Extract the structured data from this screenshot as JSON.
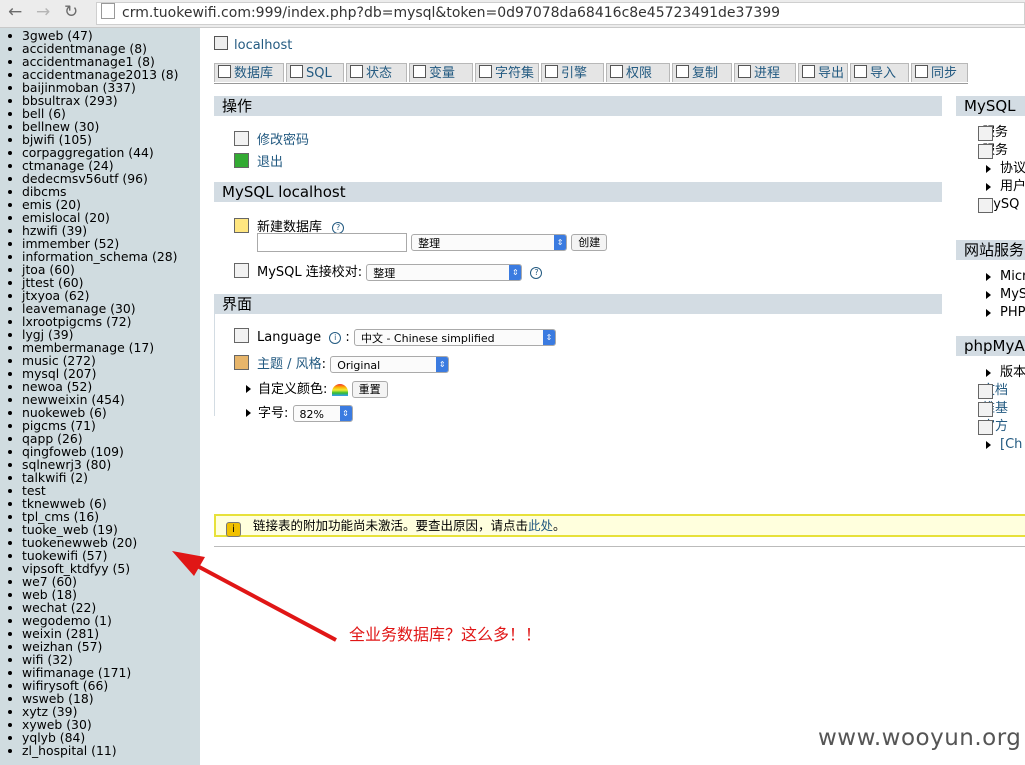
{
  "browser": {
    "back": "←",
    "forward": "→",
    "reload": "↻",
    "url": "crm.tuokewifi.com:999/index.php?db=mysql&token=0d97078da68416c8e45723491de37399"
  },
  "databases": [
    "3gweb (47)",
    "accidentmanage (8)",
    "accidentmanage1 (8)",
    "accidentmanage2013 (8)",
    "baijinmoban (337)",
    "bbsultrax (293)",
    "bell (6)",
    "bellnew (30)",
    "bjwifi (105)",
    "corpaggregation (44)",
    "ctmanage (24)",
    "dedecmsv56utf (96)",
    "dibcms",
    "emis (20)",
    "emislocal (20)",
    "hzwifi (39)",
    "immember (52)",
    "information_schema (28)",
    "jtoa (60)",
    "jttest (60)",
    "jtxyoa (62)",
    "leavemanage (30)",
    "lxrootpigcms (72)",
    "lygj (39)",
    "membermanage (17)",
    "music (272)",
    "mysql (207)",
    "newoa (52)",
    "newweixin (454)",
    "nuokeweb (6)",
    "pigcms (71)",
    "qapp (26)",
    "qingfoweb (109)",
    "sqlnewrj3 (80)",
    "talkwifi (2)",
    "test",
    "tknewweb (6)",
    "tpl_cms (16)",
    "tuoke_web (19)",
    "tuokenewweb (20)",
    "tuokewifi (57)",
    "vipsoft_ktdfyy (5)",
    "we7 (60)",
    "web (18)",
    "wechat (22)",
    "wegodemo (1)",
    "weixin (281)",
    "weizhan (57)",
    "wifi (32)",
    "wifimanage (171)",
    "wifirysoft (66)",
    "wsweb (18)",
    "xytz (39)",
    "xyweb (30)",
    "yqlyb (84)",
    "zl_hospital (11)"
  ],
  "server": "localhost",
  "tabs": [
    {
      "label": "数据库",
      "icon": "database-icon"
    },
    {
      "label": "SQL",
      "icon": "sql-icon"
    },
    {
      "label": "状态",
      "icon": "status-icon"
    },
    {
      "label": "变量",
      "icon": "variables-icon"
    },
    {
      "label": "字符集",
      "icon": "charset-icon"
    },
    {
      "label": "引擎",
      "icon": "engine-icon"
    },
    {
      "label": "权限",
      "icon": "privileges-icon"
    },
    {
      "label": "复制",
      "icon": "replication-icon"
    },
    {
      "label": "进程",
      "icon": "process-icon"
    },
    {
      "label": "导出",
      "icon": "export-icon"
    },
    {
      "label": "导入",
      "icon": "import-icon"
    },
    {
      "label": "同步",
      "icon": "sync-icon"
    }
  ],
  "ops": {
    "title": "操作",
    "change_password": "修改密码",
    "logout": "退出"
  },
  "mysql_local": {
    "title": "MySQL localhost",
    "new_db_label": "新建数据库",
    "help": "?",
    "collation_select": "整理",
    "create_button": "创建",
    "conn_collation_label": "MySQL 连接校对:",
    "conn_collation_value": "整理"
  },
  "ui": {
    "title": "界面",
    "language_label": "Language",
    "language_value": "中文 - Chinese simplified",
    "theme_label": "主题 / 风格",
    "theme_colon": ":",
    "theme_value": "Original",
    "custom_color_label": "自定义颜色:",
    "reset_button": "重置",
    "font_size_label": "字号:",
    "font_size_value": "82%"
  },
  "right_panel": {
    "mysql_title": "MySQL",
    "mysql_items": [
      "服务",
      "服务",
      "协议",
      "用户",
      "MySQ"
    ],
    "web_title": "网站服务",
    "web_items": [
      "Micr",
      "MyS",
      "PHP"
    ],
    "pma_title": "phpMyA",
    "pma_items": [
      "版本",
      "文档",
      "维基",
      "官方",
      "[Ch"
    ]
  },
  "notice": {
    "icon": "i",
    "text": "链接表的附加功能尚未激活。要查出原因，请点击",
    "link": "此处",
    "end": "。"
  },
  "annotation": "全业务数据库？这么多！！",
  "watermark": "www.wooyun.org",
  "colors": {
    "sidebar_bg": "#d0dce0",
    "header_bg": "#d3dce3",
    "link": "#235a81",
    "annotation": "#e01616",
    "notice_bg": "#ffffdd"
  }
}
